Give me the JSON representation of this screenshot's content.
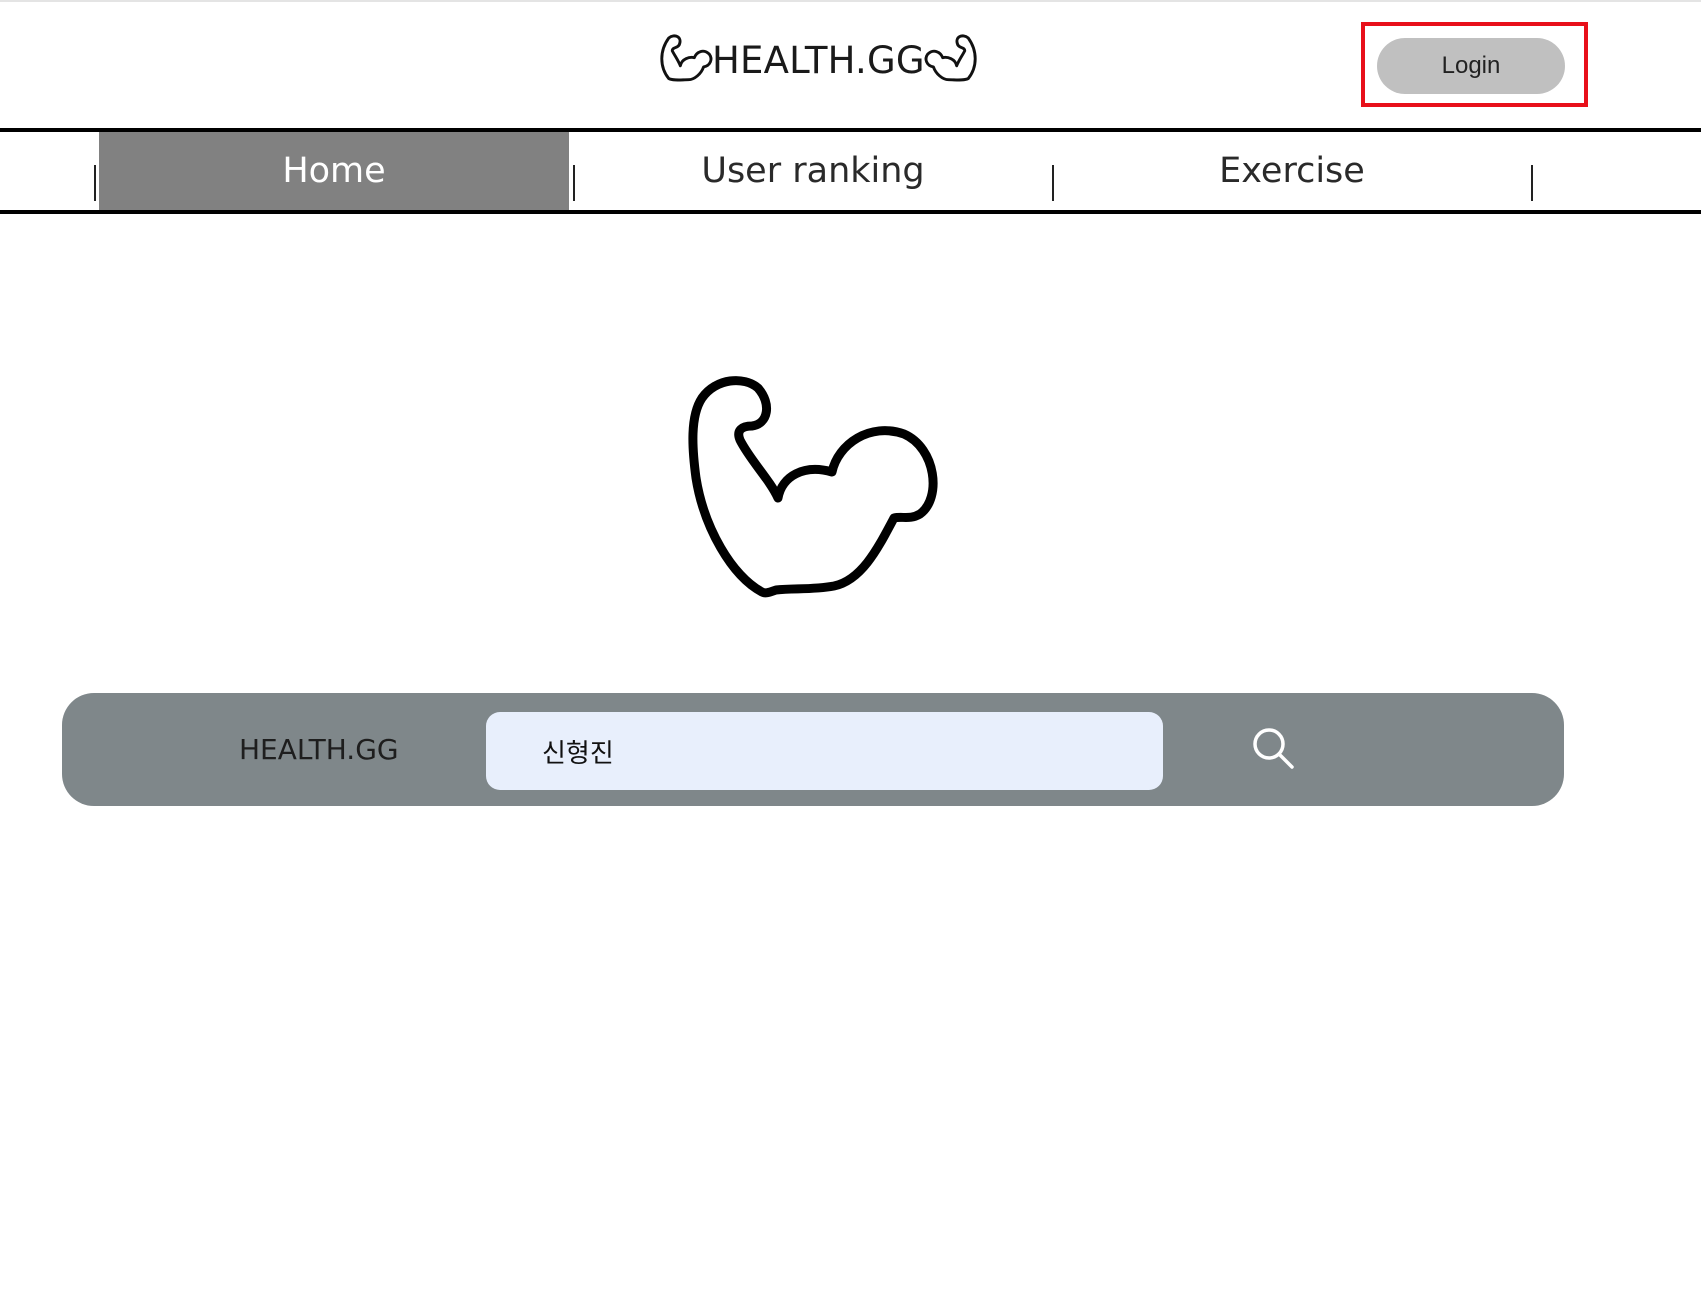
{
  "header": {
    "logo_text": "HEALTH.GG",
    "login_label": "Login"
  },
  "nav": {
    "items": [
      {
        "label": "Home",
        "active": true
      },
      {
        "label": "User ranking",
        "active": false
      },
      {
        "label": "Exercise",
        "active": false
      }
    ]
  },
  "search": {
    "brand_label": "HEALTH.GG",
    "value": "신형진",
    "placeholder": ""
  },
  "icons": {
    "logo_left": "flexed-arm-icon",
    "logo_right": "flexed-arm-icon",
    "hero": "flexed-arm-icon",
    "search": "search-icon"
  },
  "colors": {
    "nav_active_bg": "#818181",
    "login_bg": "#c0c0c0",
    "highlight": "#e8101a",
    "search_bar_bg": "#7f878a",
    "search_input_bg": "#e8effc"
  }
}
